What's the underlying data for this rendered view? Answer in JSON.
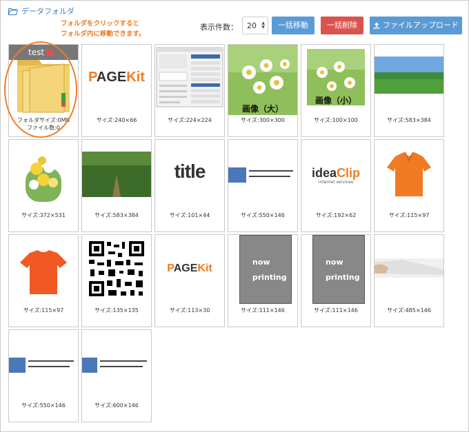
{
  "breadcrumb": {
    "label": "データフォルダ"
  },
  "annotation": {
    "line1": "フォルダをクリックすると",
    "line2": "フォルダ内に移動できます。"
  },
  "toolbar": {
    "count_label": "表示件数：",
    "count_value": "20",
    "move_label": "一括移動",
    "delete_label": "一括削除",
    "upload_label": "ファイルアップロード"
  },
  "folder": {
    "name": "test",
    "size": "フォルダサイズ:0MB",
    "count": "ファイル数:0"
  },
  "thumb_texts": {
    "pagekit": "PAGEKit",
    "pagekit_p": "P",
    "pagekit_age": "AGE",
    "pagekit_kit": "Kit",
    "image_large": "画像（大）",
    "image_small": "画像（小）",
    "title": "title",
    "idea": "idea",
    "clip": "Clip",
    "idea_sub": "internet services",
    "now": "now",
    "printing": "printing"
  },
  "files": [
    {
      "caption": "サイズ:240×66"
    },
    {
      "caption": "サイズ:224×224"
    },
    {
      "caption": "サイズ:300×300"
    },
    {
      "caption": "サイズ:100×100"
    },
    {
      "caption": "サイズ:583×384"
    },
    {
      "caption": "サイズ:372×531"
    },
    {
      "caption": "サイズ:583×384"
    },
    {
      "caption": "サイズ:101×44"
    },
    {
      "caption": "サイズ:550×146"
    },
    {
      "caption": "サイズ:192×62"
    },
    {
      "caption": "サイズ:115×97"
    },
    {
      "caption": "サイズ:115×97"
    },
    {
      "caption": "サイズ:135×135"
    },
    {
      "caption": "サイズ:113×30"
    },
    {
      "caption": "サイズ:111×146"
    },
    {
      "caption": "サイズ:111×146"
    },
    {
      "caption": "サイズ:485×146"
    },
    {
      "caption": "サイズ:550×146"
    },
    {
      "caption": "サイズ:600×146"
    }
  ],
  "colors": {
    "accent": "#f07b22",
    "primary": "#5b9bd5",
    "danger": "#d9534f"
  }
}
